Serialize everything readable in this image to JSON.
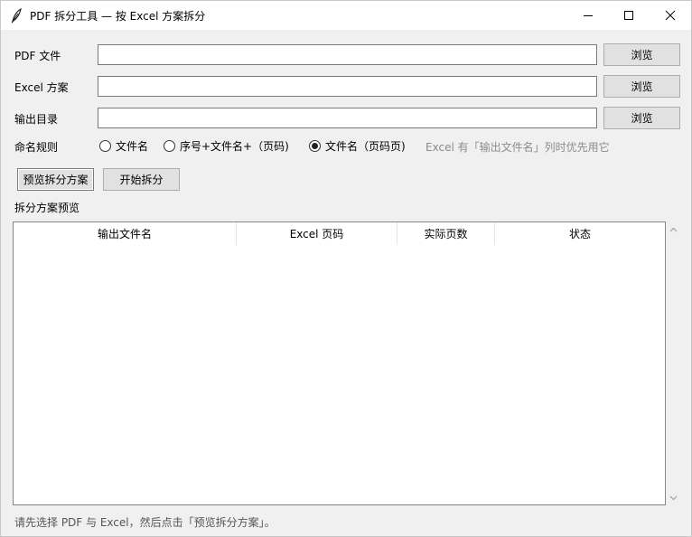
{
  "window": {
    "title": "PDF 拆分工具 — 按 Excel 方案拆分"
  },
  "form": {
    "pdf_label": "PDF 文件",
    "pdf_value": "",
    "excel_label": "Excel 方案",
    "excel_value": "",
    "output_label": "输出目录",
    "output_value": "",
    "browse_label": "浏览"
  },
  "naming": {
    "label": "命名规则",
    "options": [
      {
        "label": "文件名",
        "checked": false
      },
      {
        "label": "序号+文件名+（页码)",
        "checked": false
      },
      {
        "label": "文件名（页码页)",
        "checked": true
      }
    ],
    "hint": "Excel 有「输出文件名」列时优先用它"
  },
  "actions": {
    "preview_label": "预览拆分方案",
    "start_label": "开始拆分"
  },
  "preview": {
    "section_label": "拆分方案预览",
    "columns": [
      "输出文件名",
      "Excel 页码",
      "实际页数",
      "状态"
    ],
    "rows": []
  },
  "status_text": "请先选择 PDF 与 Excel，然后点击「预览拆分方案」。"
}
